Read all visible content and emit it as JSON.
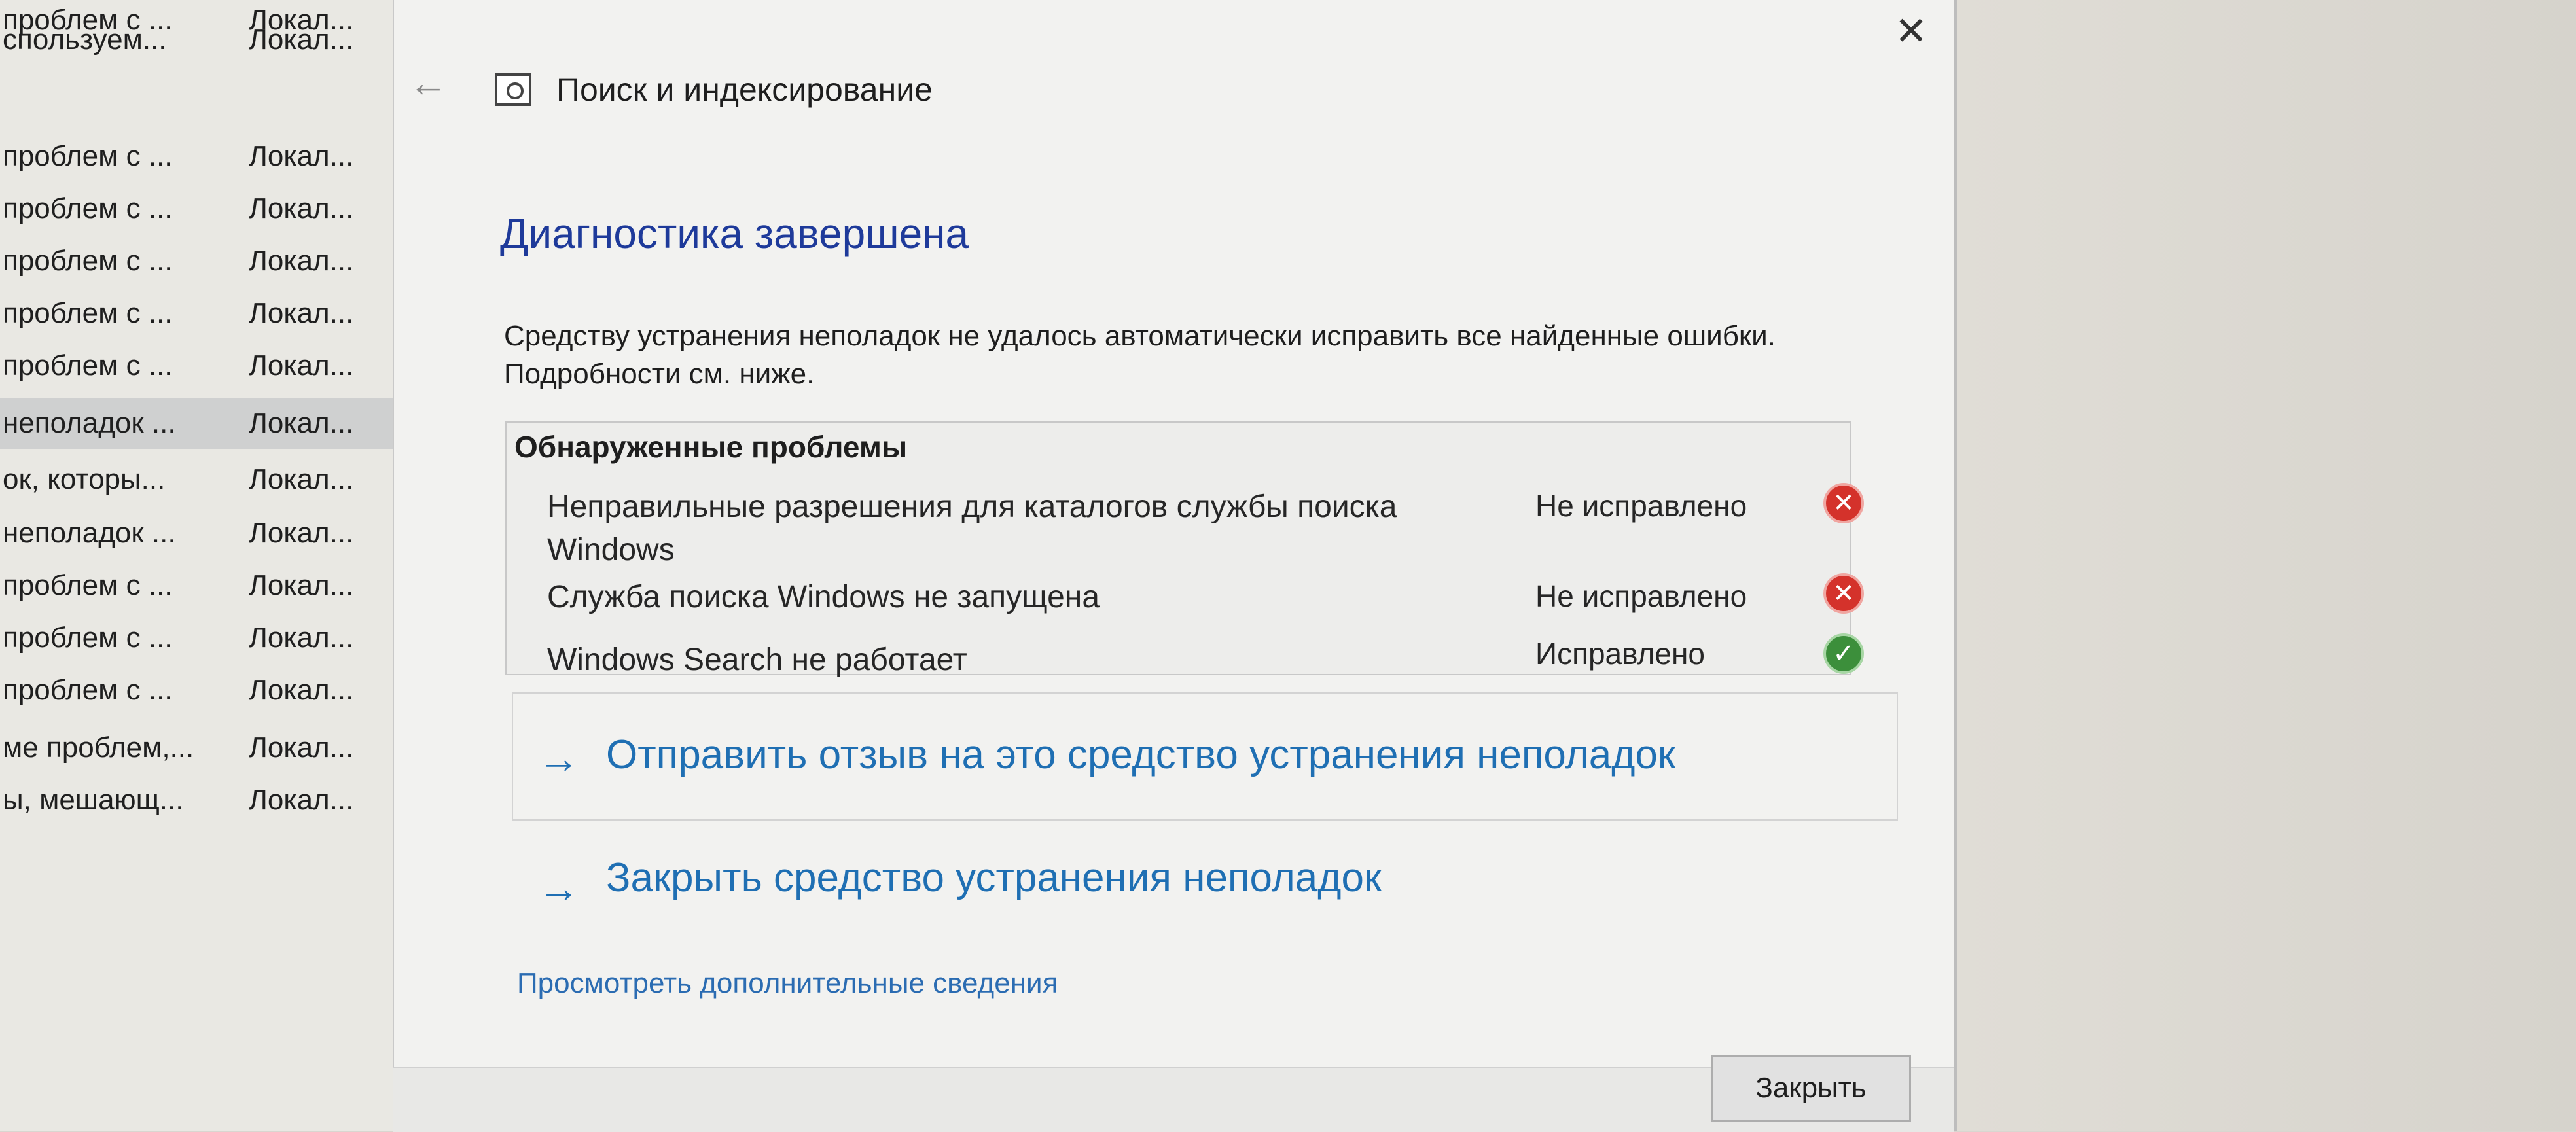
{
  "background_list": {
    "rows": [
      {
        "name": "проблем с ...",
        "type": "Локал..."
      },
      {
        "name": "спользуем...",
        "type": "Локал..."
      },
      {
        "name": "проблем с ...",
        "type": "Локал..."
      },
      {
        "name": "проблем с ...",
        "type": "Локал..."
      },
      {
        "name": "проблем с ...",
        "type": "Локал..."
      },
      {
        "name": "проблем с ...",
        "type": "Локал..."
      },
      {
        "name": "проблем с ...",
        "type": "Локал..."
      },
      {
        "name": "неполадок ...",
        "type": "Локал...",
        "selected": true
      },
      {
        "name": "ок, которы...",
        "type": "Локал..."
      },
      {
        "name": "неполадок ...",
        "type": "Локал..."
      },
      {
        "name": "проблем с ...",
        "type": "Локал..."
      },
      {
        "name": "проблем с ...",
        "type": "Локал..."
      },
      {
        "name": "проблем с ...",
        "type": "Локал..."
      },
      {
        "name": "ме проблем,...",
        "type": "Локал..."
      },
      {
        "name": "ы, мешающ...",
        "type": "Локал..."
      }
    ]
  },
  "dialog": {
    "close_glyph": "✕",
    "back_glyph": "←",
    "title": "Поиск и индексирование",
    "heading": "Диагностика завершена",
    "description": "Средству устранения неполадок не удалось автоматически исправить все найденные ошибки. Подробности см. ниже.",
    "problems": {
      "header": "Обнаруженные проблемы",
      "items": [
        {
          "label": "Неправильные разрешения для каталогов службы поиска Windows",
          "status": "Не исправлено",
          "icon": "error-icon",
          "glyph": "✕"
        },
        {
          "label": "Служба поиска Windows не запущена",
          "status": "Не исправлено",
          "icon": "error-icon",
          "glyph": "✕"
        },
        {
          "label": "Windows Search не работает",
          "status": "Исправлено",
          "icon": "check-icon",
          "glyph": "✓"
        }
      ]
    },
    "links": {
      "arrow": "→",
      "feedback": "Отправить отзыв на это средство устранения неполадок",
      "close_troubleshooter": "Закрыть средство устранения неполадок",
      "more_info": "Просмотреть дополнительные сведения"
    },
    "footer": {
      "close_button": "Закрыть"
    }
  },
  "colors": {
    "heading": "#1e3a9a",
    "link": "#1f6fb3",
    "error": "#d4322b",
    "success": "#3c8f3b"
  }
}
